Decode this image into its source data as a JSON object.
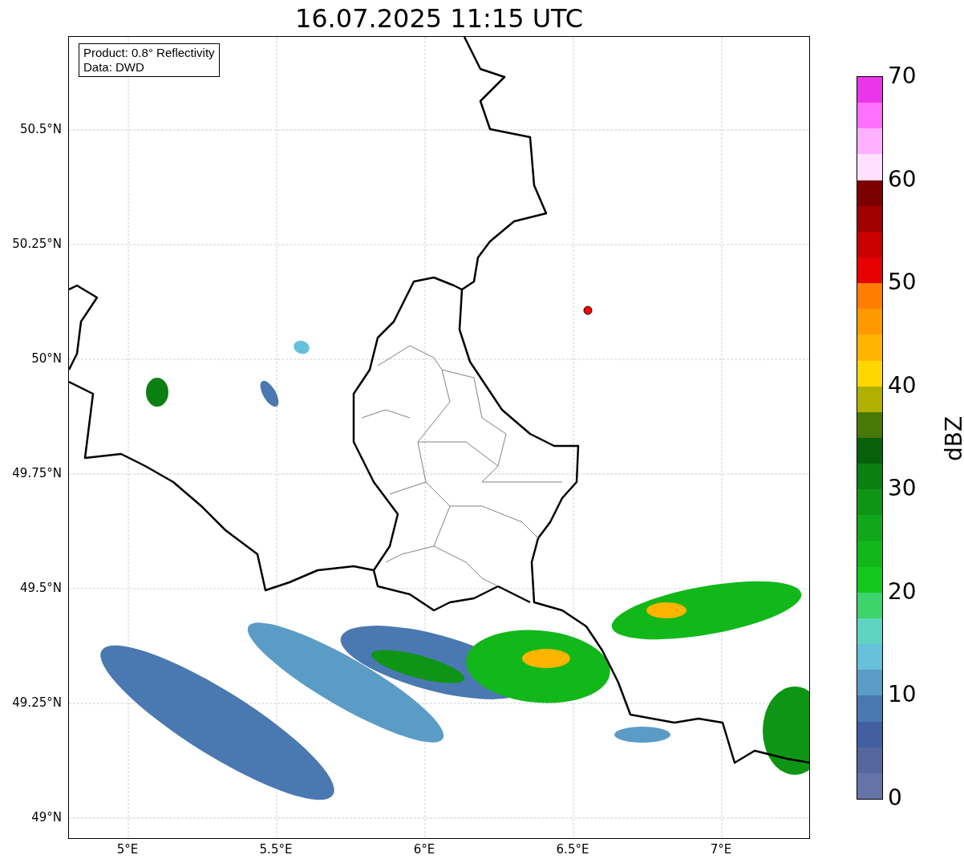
{
  "title": "16.07.2025 11:15 UTC",
  "map": {
    "legend": [
      "Product: 0.8° Reflectivity",
      "Data: DWD"
    ],
    "lat_ticks": [
      "50.5°N",
      "50.25°N",
      "50°N",
      "49.75°N",
      "49.5°N",
      "49.25°N",
      "49°N"
    ],
    "lon_ticks": [
      "5°E",
      "5.5°E",
      "6°E",
      "6.5°E",
      "7°E"
    ]
  },
  "colorbar": {
    "label": "dBZ",
    "ticks": [
      "70",
      "60",
      "50",
      "40",
      "30",
      "20",
      "10",
      "0"
    ],
    "segments": [
      {
        "color": "#6474a8"
      },
      {
        "color": "#56669f"
      },
      {
        "color": "#445ea2"
      },
      {
        "color": "#4a78b0"
      },
      {
        "color": "#5a9cc6"
      },
      {
        "color": "#66c0da"
      },
      {
        "color": "#5ed4c0"
      },
      {
        "color": "#3dd46c"
      },
      {
        "color": "#14c81e"
      },
      {
        "color": "#12b81a"
      },
      {
        "color": "#10a818"
      },
      {
        "color": "#0e9515"
      },
      {
        "color": "#0c7f12"
      },
      {
        "color": "#07600c"
      },
      {
        "color": "#487808"
      },
      {
        "color": "#b0b000"
      },
      {
        "color": "#ffd700"
      },
      {
        "color": "#ffb400"
      },
      {
        "color": "#ff9900"
      },
      {
        "color": "#ff7d00"
      },
      {
        "color": "#e60000"
      },
      {
        "color": "#c80000"
      },
      {
        "color": "#a00000"
      },
      {
        "color": "#7d0000"
      },
      {
        "color": "#ffe0ff"
      },
      {
        "color": "#ffb0ff"
      },
      {
        "color": "#ff70ff"
      },
      {
        "color": "#ea35ea"
      }
    ]
  }
}
